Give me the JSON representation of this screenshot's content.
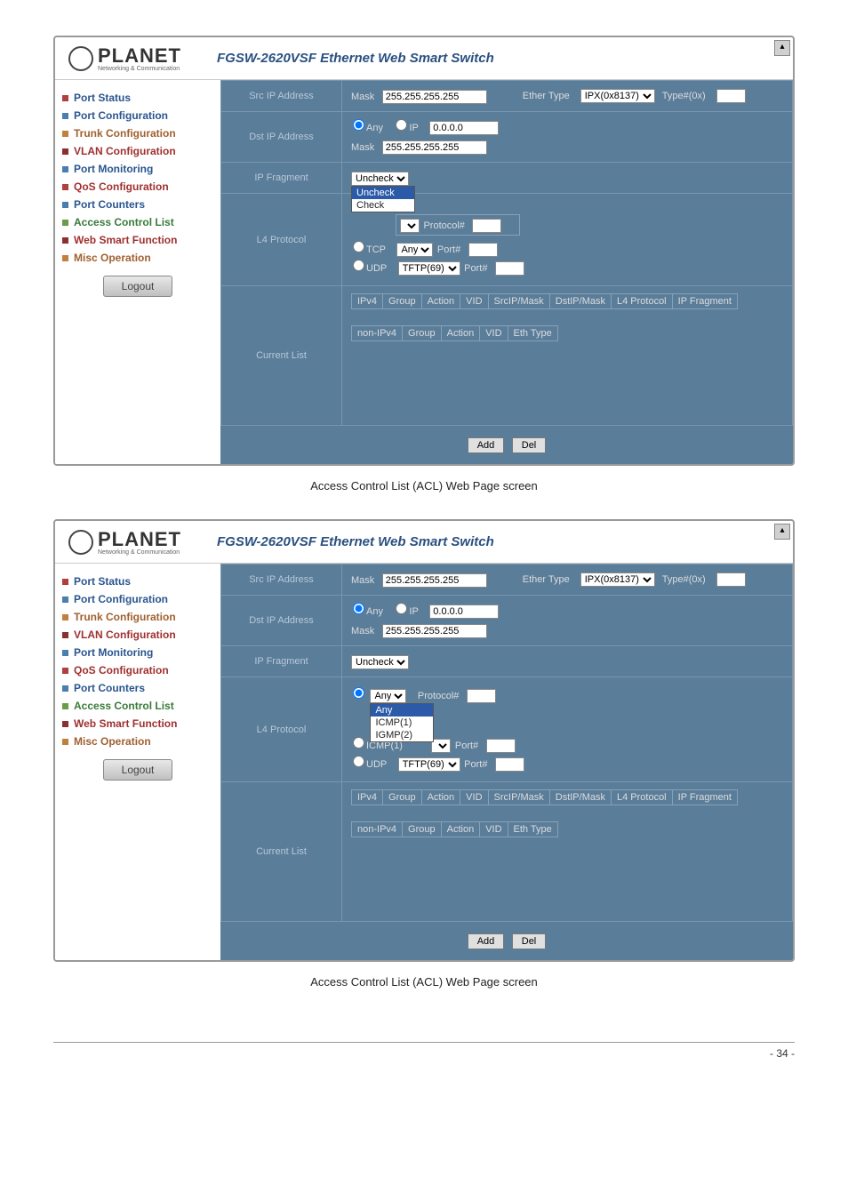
{
  "logo_text": "PLANET",
  "logo_sub": "Networking & Communication",
  "product_title": "FGSW-2620VSF Ethernet Web Smart Switch",
  "sidebar": {
    "items": [
      {
        "label": "Port Status"
      },
      {
        "label": "Port Configuration"
      },
      {
        "label": "Trunk Configuration"
      },
      {
        "label": "VLAN Configuration"
      },
      {
        "label": "Port Monitoring"
      },
      {
        "label": "QoS Configuration"
      },
      {
        "label": "Port Counters"
      },
      {
        "label": "Access Control List"
      },
      {
        "label": "Web Smart Function"
      },
      {
        "label": "Misc Operation"
      }
    ],
    "logout": "Logout"
  },
  "panel1": {
    "src_ip_label": "Src IP Address",
    "dst_ip_label": "Dst IP Address",
    "ip_fragment_label": "IP Fragment",
    "l4_protocol_label": "L4 Protocol",
    "current_list_label": "Current List",
    "mask_label": "Mask",
    "mask_value": "255.255.255.255",
    "ether_type_label": "Ether Type",
    "ether_select": "IPX(0x8137)",
    "type_hash_label": "Type#(0x)",
    "type_hash_value": "",
    "any_label": "Any",
    "ip_label": "IP",
    "ip_value": "0.0.0.0",
    "dst_mask": "255.255.255.255",
    "fragment_select": "Uncheck",
    "fragment_opts": [
      "Uncheck",
      "Check"
    ],
    "protocol_label": "Protocol#",
    "protocol_value": "",
    "tcp_label": "TCP",
    "tcp_select": "Any",
    "port_label": "Port#",
    "port_value": "",
    "udp_label": "UDP",
    "udp_select": "TFTP(69)",
    "udp_port_value": "",
    "ipv4_headers": [
      "IPv4",
      "Group",
      "Action",
      "VID",
      "SrcIP/Mask",
      "DstIP/Mask",
      "L4 Protocol",
      "IP Fragment"
    ],
    "nonipv4_headers": [
      "non-IPv4",
      "Group",
      "Action",
      "VID",
      "Eth Type"
    ],
    "add_btn": "Add",
    "del_btn": "Del"
  },
  "panel2": {
    "src_ip_label": "Src IP Address",
    "dst_ip_label": "Dst IP Address",
    "ip_fragment_label": "IP Fragment",
    "l4_protocol_label": "L4 Protocol",
    "current_list_label": "Current List",
    "mask_label": "Mask",
    "mask_value": "255.255.255.255",
    "ether_type_label": "Ether Type",
    "ether_select": "IPX(0x8137)",
    "type_hash_label": "Type#(0x)",
    "type_hash_value": "",
    "any_label": "Any",
    "ip_label": "IP",
    "ip_value": "0.0.0.0",
    "dst_mask": "255.255.255.255",
    "fragment_select": "Uncheck",
    "l4_select": "Any",
    "l4_opts": [
      "Any",
      "ICMP(1)",
      "IGMP(2)"
    ],
    "protocol_label": "Protocol#",
    "protocol_value": "",
    "icmp_label": "ICMP(1)",
    "port_label": "Port#",
    "port_value": "",
    "udp_label": "UDP",
    "udp_select": "TFTP(69)",
    "udp_port_value": "",
    "ipv4_headers": [
      "IPv4",
      "Group",
      "Action",
      "VID",
      "SrcIP/Mask",
      "DstIP/Mask",
      "L4 Protocol",
      "IP Fragment"
    ],
    "nonipv4_headers": [
      "non-IPv4",
      "Group",
      "Action",
      "VID",
      "Eth Type"
    ],
    "add_btn": "Add",
    "del_btn": "Del"
  },
  "caption": "Access Control List (ACL) Web Page screen",
  "page_number": "- 34 -"
}
